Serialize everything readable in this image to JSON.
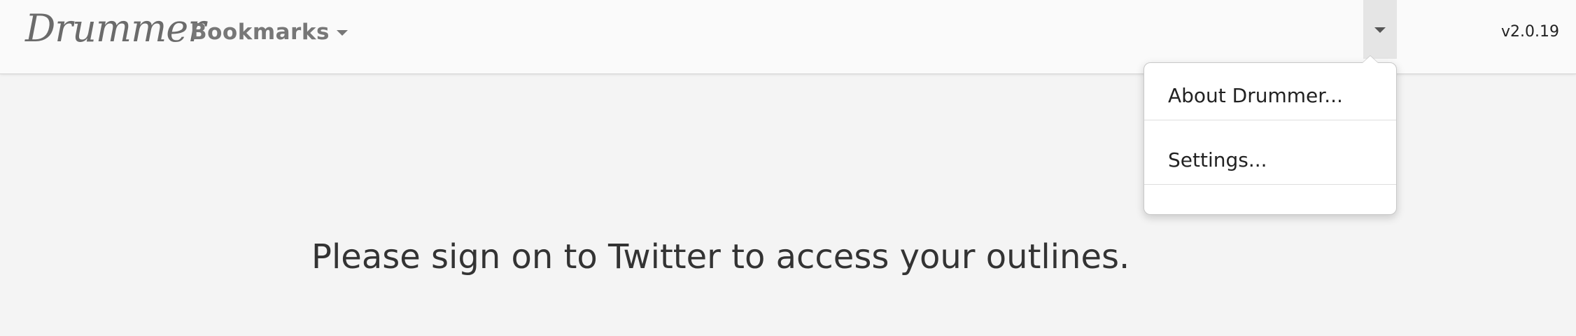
{
  "navbar": {
    "brand": "Drummer",
    "bookmarks_label": "Bookmarks",
    "version": "v2.0.19"
  },
  "user_menu": {
    "items": [
      {
        "label": "About Drummer..."
      },
      {
        "label": "Settings..."
      }
    ]
  },
  "main": {
    "message": "Please sign on to Twitter to access your outlines."
  },
  "icons": {
    "bookmarks_caret": "chevron-down-icon",
    "user_menu_caret": "chevron-down-icon"
  },
  "colors": {
    "background": "#f4f4f4",
    "navbar": "#fafafa",
    "toggle_active": "#e5e5e5"
  }
}
